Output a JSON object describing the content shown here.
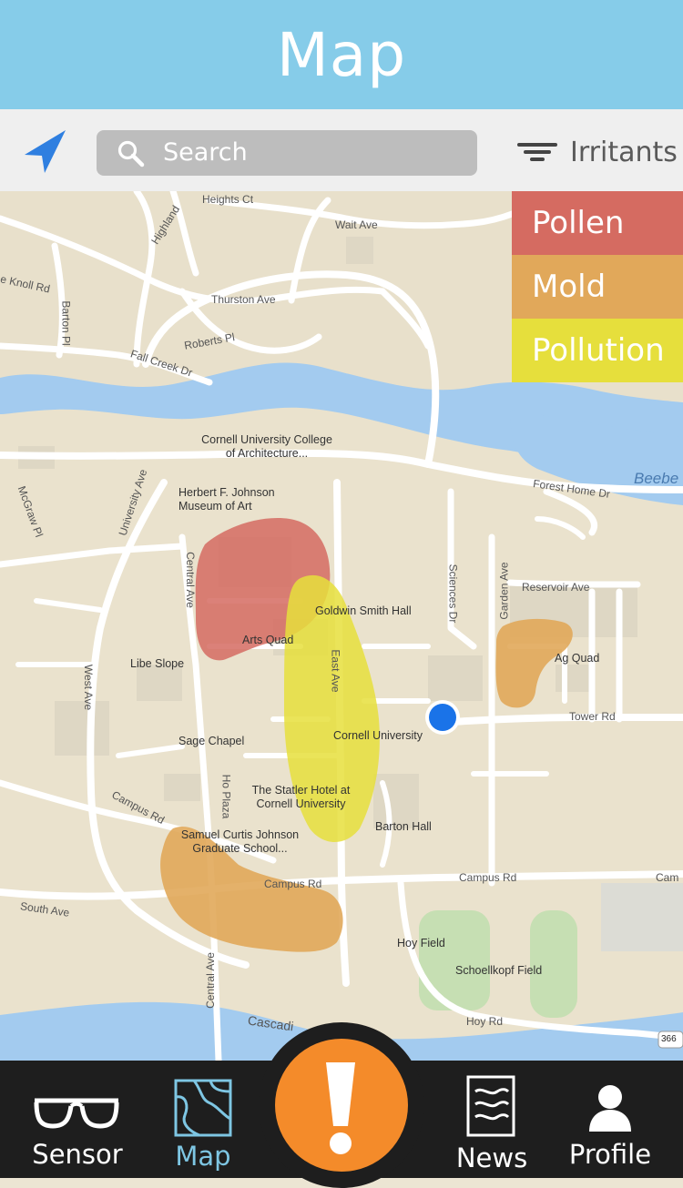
{
  "header": {
    "title": "Map"
  },
  "toolbar": {
    "location_icon": "navigation-arrow-icon",
    "search_placeholder": "Search",
    "filter_label": "Irritants",
    "filter_icon": "filter-lines-icon"
  },
  "legend": [
    {
      "label": "Pollen",
      "color": "#d56b61"
    },
    {
      "label": "Mold",
      "color": "#e1a85a"
    },
    {
      "label": "Pollution",
      "color": "#e6df3c"
    }
  ],
  "map": {
    "streets": [
      "Heights Ct",
      "Highland",
      "Wait Ave",
      "e Knoll Rd",
      "Barton Pl",
      "Thurston Ave",
      "Roberts Pl",
      "Fall Creek Dr",
      "University Ave",
      "McGraw Pl",
      "Forest Home Dr",
      "Beebe",
      "Central Ave",
      "Sciences Dr",
      "Garden Ave",
      "Reservoir Ave",
      "East Ave",
      "West Ave",
      "Tower Rd",
      "Ho Plaza",
      "Campus Rd",
      "Campus Rd",
      "Campus Rd",
      "Cam",
      "South Ave",
      "Central Ave",
      "Cascadi",
      "Hoy Rd",
      "366"
    ],
    "pois": [
      "Cornell University College of Architecture...",
      "Herbert F. Johnson Museum of Art",
      "Goldwin Smith Hall",
      "Arts Quad",
      "Libe Slope",
      "Ag Quad",
      "Cornell University",
      "Sage Chapel",
      "The Statler Hotel at Cornell University",
      "Barton Hall",
      "Samuel Curtis Johnson Graduate School...",
      "Hoy Field",
      "Schoellkopf Field"
    ]
  },
  "nav": {
    "tabs": [
      {
        "label": "Sensor",
        "icon": "glasses-icon",
        "active": false
      },
      {
        "label": "Map",
        "icon": "map-icon",
        "active": true
      },
      {
        "label": "News",
        "icon": "news-icon",
        "active": false
      },
      {
        "label": "Profile",
        "icon": "person-icon",
        "active": false
      }
    ],
    "alert_icon": "exclamation-icon",
    "alert_color": "#f48b2a",
    "active_color": "#7ec6e3"
  }
}
